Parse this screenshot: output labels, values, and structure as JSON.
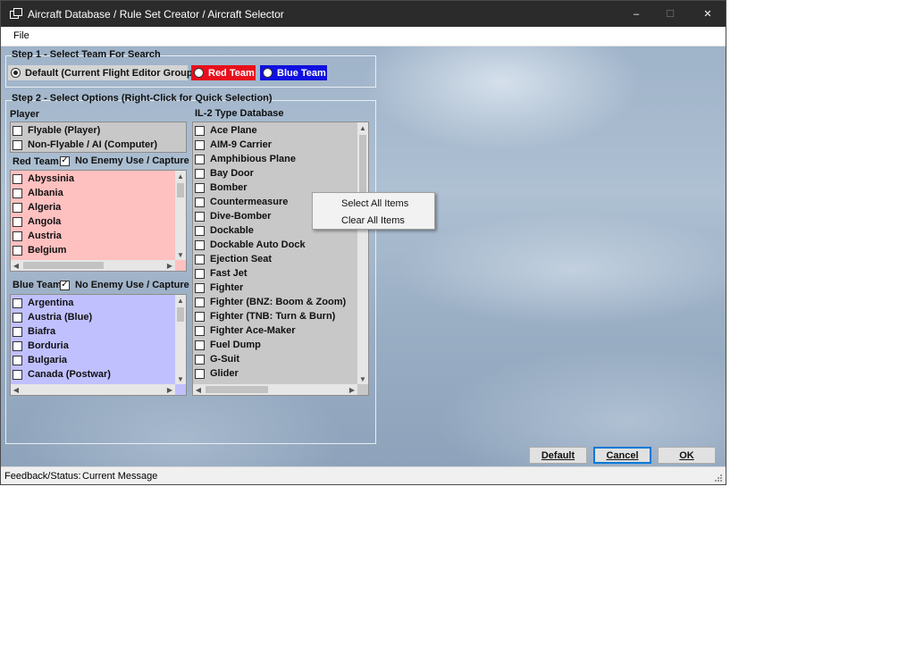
{
  "window": {
    "title": "Aircraft Database / Rule Set Creator / Aircraft Selector",
    "controls": {
      "minimize": "–",
      "maximize": "☐",
      "close": "✕"
    }
  },
  "menu": {
    "file": "File"
  },
  "step1": {
    "title": "Step 1 - Select Team For Search",
    "options": [
      {
        "label": "Default (Current Flight Editor Group)",
        "selected": true,
        "bg": "#d4d4d4",
        "fg": "#111111"
      },
      {
        "label": "Red Team",
        "selected": false,
        "bg": "#e8101c",
        "fg": "#ffffff"
      },
      {
        "label": "Blue Team",
        "selected": false,
        "bg": "#1010e0",
        "fg": "#ffffff"
      }
    ]
  },
  "step2": {
    "title": "Step 2 - Select Options (Right-Click for Quick Selection)",
    "player": {
      "label": "Player",
      "items": [
        "Flyable (Player)",
        "Non-Flyable / AI (Computer)"
      ]
    },
    "red_team": {
      "label": "Red Team",
      "option": "No Enemy Use / Capture",
      "option_checked": true,
      "bg": "#ffc0c0",
      "items": [
        "Abyssinia",
        "Albania",
        "Algeria",
        "Angola",
        "Austria",
        "Belgium"
      ]
    },
    "blue_team": {
      "label": "Blue Team",
      "option": "No Enemy Use / Capture",
      "option_checked": true,
      "bg": "#c0c0ff",
      "items": [
        "Argentina",
        "Austria (Blue)",
        "Biafra",
        "Borduria",
        "Bulgaria",
        "Canada (Postwar)"
      ]
    },
    "type_db": {
      "label": "IL-2 Type Database",
      "items": [
        "Ace Plane",
        "AIM-9 Carrier",
        "Amphibious Plane",
        "Bay Door",
        "Bomber",
        "Countermeasure",
        "Dive-Bomber",
        "Dockable",
        "Dockable Auto Dock",
        "Ejection Seat",
        "Fast Jet",
        "Fighter",
        "Fighter (BNZ: Boom & Zoom)",
        "Fighter (TNB: Turn & Burn)",
        "Fighter Ace-Maker",
        "Fuel Dump",
        "G-Suit",
        "Glider"
      ]
    }
  },
  "context_menu": {
    "items": [
      "Select All Items",
      "Clear All Items"
    ]
  },
  "buttons": {
    "default": "Default",
    "cancel": "Cancel",
    "ok": "OK"
  },
  "status": {
    "label": "Feedback/Status:",
    "message": "Current Message"
  },
  "scroll": {
    "up": "▲",
    "down": "▼",
    "left": "◀",
    "right": "▶"
  }
}
